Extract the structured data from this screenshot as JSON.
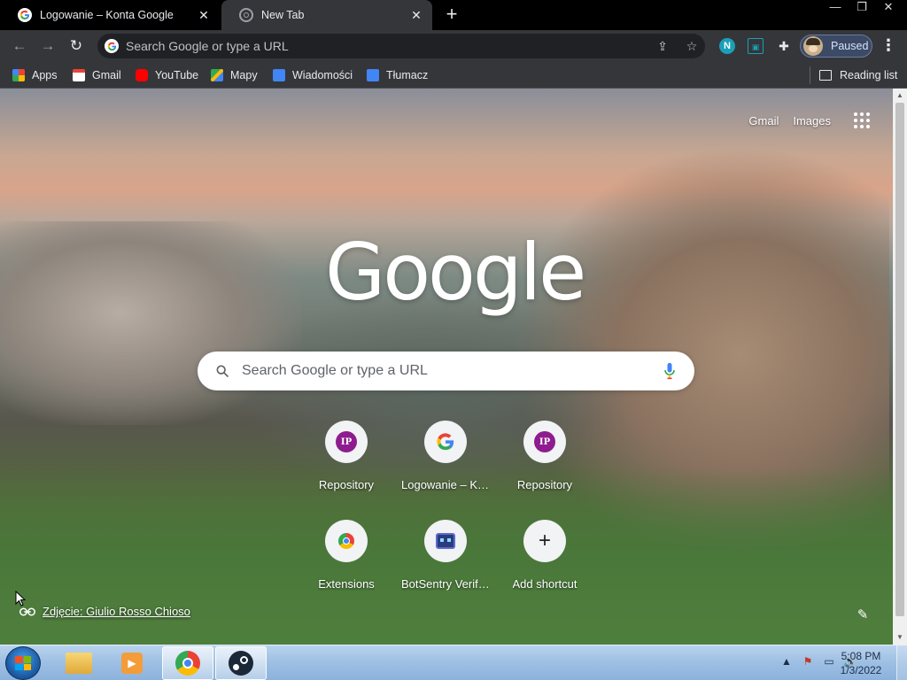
{
  "tabs": [
    {
      "title": "Logowanie – Konta Google",
      "active": false
    },
    {
      "title": "New Tab",
      "active": true
    }
  ],
  "window_controls": {
    "minimize": "—",
    "restore": "❐",
    "close": "✕"
  },
  "toolbar": {
    "omnibox_placeholder": "Search Google or type a URL",
    "profile_label": "Paused",
    "extension_n": "N"
  },
  "bookmarks": [
    {
      "label": "Apps",
      "icon": "apps-grid-icon"
    },
    {
      "label": "Gmail",
      "icon": "gmail-icon"
    },
    {
      "label": "YouTube",
      "icon": "youtube-icon"
    },
    {
      "label": "Mapy",
      "icon": "maps-icon"
    },
    {
      "label": "Wiadomości",
      "icon": "news-icon"
    },
    {
      "label": "Tłumacz",
      "icon": "translate-icon"
    }
  ],
  "reading_list": "Reading list",
  "ntp": {
    "top_links": {
      "gmail": "Gmail",
      "images": "Images"
    },
    "logo": "Google",
    "search_placeholder": "Search Google or type a URL",
    "shortcuts": [
      {
        "label": "Repository",
        "icon": "ip-icon"
      },
      {
        "label": "Logowanie – Konta Google",
        "icon": "google-g-icon"
      },
      {
        "label": "Repository",
        "icon": "ip-icon"
      },
      {
        "label": "Extensions",
        "icon": "chrome-icon"
      },
      {
        "label": "BotSentry Verification",
        "icon": "botsentry-icon"
      },
      {
        "label": "Add shortcut",
        "icon": "plus-icon"
      }
    ],
    "attribution": "Zdjęcie: Giulio Rosso Chioso"
  },
  "taskbar": {
    "time": "5:08 PM",
    "date": "1/3/2022"
  },
  "colors": {
    "tab_bar": "#000000",
    "toolbar": "#35363a",
    "omnibox": "#202124",
    "profile_chip": "#3c4a66",
    "ip_badge": "#8e1c8e"
  }
}
